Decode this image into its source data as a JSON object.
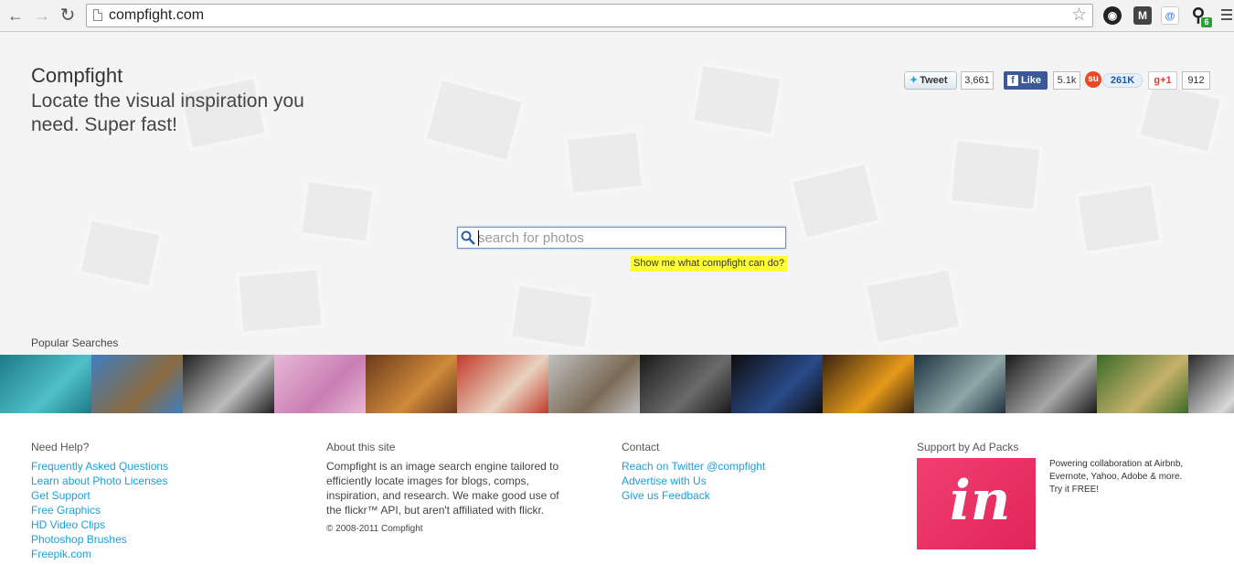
{
  "browser": {
    "url": "compfight.com",
    "badge_count": "6"
  },
  "hero": {
    "brand": "Compfight",
    "tagline": "Locate the visual inspiration you need. Super fast!",
    "search_placeholder": "search for photos",
    "demo_link": "Show me what compfight can do?",
    "popular_label": "Popular Searches"
  },
  "social": {
    "tweet_label": "Tweet",
    "tweet_count": "3,661",
    "like_label": "Like",
    "like_count": "5.1k",
    "stumble_count": "261K",
    "gplus_label": "+1",
    "gplus_count": "912"
  },
  "thumbnails": [
    {
      "name": "thumb-green-face",
      "c1": "#1e7a86",
      "c2": "#4fc0c8"
    },
    {
      "name": "thumb-pier",
      "c1": "#3f7fbf",
      "c2": "#8a6a40"
    },
    {
      "name": "thumb-tunnel-bw",
      "c1": "#202020",
      "c2": "#bdbdbd"
    },
    {
      "name": "thumb-girl-pink-wall",
      "c1": "#e7b8d5",
      "c2": "#c97eb4"
    },
    {
      "name": "thumb-beagle",
      "c1": "#6b3a1c",
      "c2": "#d08a3a"
    },
    {
      "name": "thumb-geishas",
      "c1": "#c23a2a",
      "c2": "#e9d3c0"
    },
    {
      "name": "thumb-ducks",
      "c1": "#bfbfbf",
      "c2": "#7b6b55"
    },
    {
      "name": "thumb-gadgets",
      "c1": "#1a1a1a",
      "c2": "#6b6b6b"
    },
    {
      "name": "thumb-superman",
      "c1": "#0e0e0e",
      "c2": "#2a4a8a"
    },
    {
      "name": "thumb-flower",
      "c1": "#3a2410",
      "c2": "#e69a1a"
    },
    {
      "name": "thumb-fly",
      "c1": "#1e3340",
      "c2": "#8fa7a8"
    },
    {
      "name": "thumb-bw-portrait",
      "c1": "#1a1a1a",
      "c2": "#a8a8a8"
    },
    {
      "name": "thumb-swamp-boat",
      "c1": "#3b6a2a",
      "c2": "#c7b26a"
    },
    {
      "name": "thumb-forest-bw",
      "c1": "#2a2a2a",
      "c2": "#d9d9d9"
    }
  ],
  "footer": {
    "help": {
      "heading": "Need Help?",
      "links": [
        "Frequently Asked Questions",
        "Learn about Photo Licenses",
        "Get Support",
        "Free Graphics",
        "HD Video Clips",
        "Photoshop Brushes",
        "Freepik.com"
      ]
    },
    "about": {
      "heading": "About this site",
      "text": "Compfight is an image search engine tailored to efficiently locate images for blogs, comps, inspiration, and research. We make good use of the flickr™ API, but aren't affiliated with flickr.",
      "copyright": "© 2008-2011 Compfight"
    },
    "contact": {
      "heading": "Contact",
      "links": [
        "Reach on Twitter @compfight",
        "Advertise with Us",
        "Give us Feedback"
      ]
    },
    "support": {
      "heading": "Support by Ad Packs",
      "ad_logo": "in",
      "ad_text": "Powering collaboration at Airbnb, Evernote, Yahoo, Adobe & more. Try it FREE!"
    }
  },
  "colors": {
    "link": "#1aa0d8",
    "highlight": "#ffff33",
    "hero_bg": "#f4f4f4",
    "ad_pink": "#e8336a"
  }
}
